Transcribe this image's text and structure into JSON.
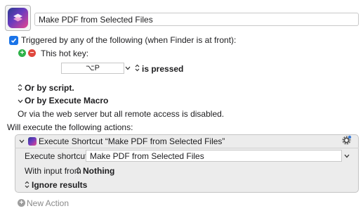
{
  "macro": {
    "title": "Make PDF from Selected Files"
  },
  "trigger": {
    "checkbox_label": "Triggered by any of the following (when Finder is at front):",
    "hotkey_label": "This hot key:",
    "hotkey_value": "⌥P",
    "is_pressed": "is pressed",
    "or_by_script": "Or by script.",
    "or_by_execute_macro": "Or by Execute Macro",
    "web_server_note": "Or via the web server but all remote access is disabled."
  },
  "actions": {
    "heading": "Will execute the following actions:",
    "items": [
      {
        "title": "Execute Shortcut “Make PDF from Selected Files”",
        "shortcut_label": "Execute shortcut:",
        "shortcut_value": "Make PDF from Selected Files",
        "input_label": "With input from",
        "input_value": "Nothing",
        "results": "Ignore results"
      }
    ],
    "new_action": "New Action"
  },
  "colors": {
    "accent_blue": "#1a73e8",
    "add_green": "#2fb24a",
    "remove_red": "#e0483e",
    "action_bg": "#ececec"
  },
  "icons": {
    "macro_icon": "shortcuts-app-icon",
    "add": "plus-circle-icon",
    "remove": "minus-circle-icon",
    "gear": "gear-icon",
    "chevron": "chevron-down-icon",
    "updown": "up-down-chevron-icon"
  }
}
